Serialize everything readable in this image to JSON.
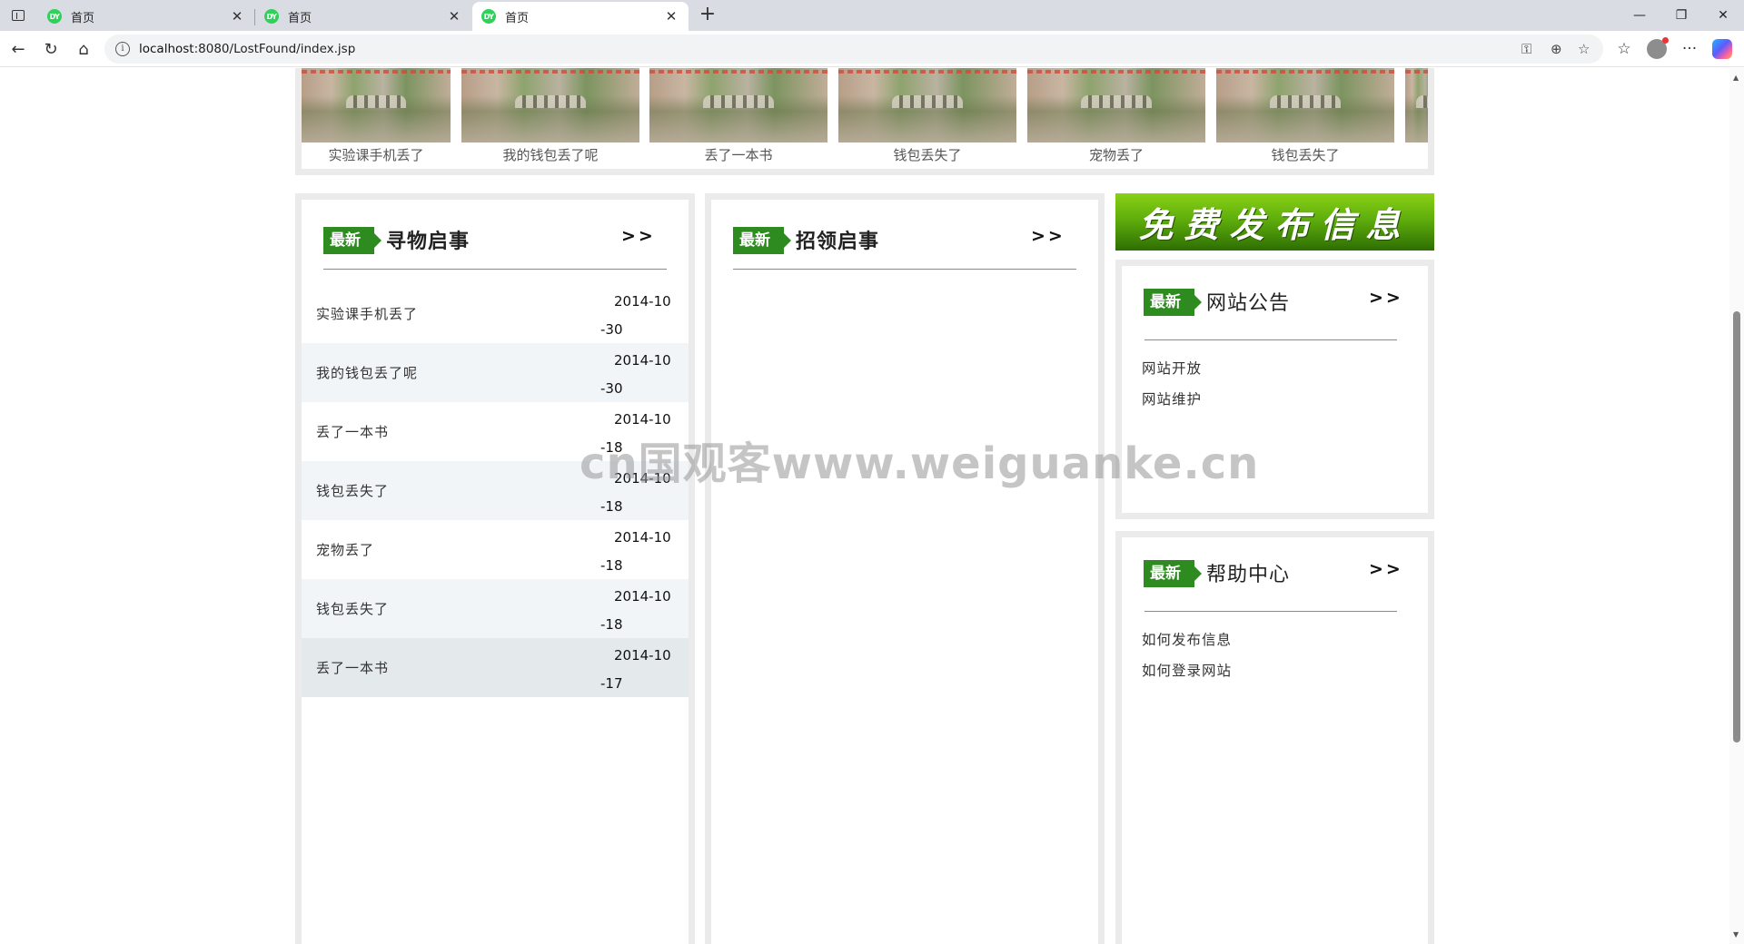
{
  "browser": {
    "tabs": [
      {
        "favicon": "DY",
        "title": "首页",
        "active": false
      },
      {
        "favicon": "DY",
        "title": "首页",
        "active": false
      },
      {
        "favicon": "DY",
        "title": "首页",
        "active": true
      }
    ],
    "url_host": "localhost",
    "url_rest": ":8080/LostFound/index.jsp",
    "icons": {
      "tab-actions": "tab-actions-icon",
      "new-tab": "+",
      "minimize": "—",
      "restore": "❐",
      "close": "✕",
      "back": "←",
      "reload": "↻",
      "home": "⌂",
      "more": "···"
    }
  },
  "carousel": {
    "items": [
      {
        "caption": "实验课手机丢了"
      },
      {
        "caption": "我的钱包丢了呢"
      },
      {
        "caption": "丢了一本书"
      },
      {
        "caption": "钱包丢失了"
      },
      {
        "caption": "宠物丢了"
      },
      {
        "caption": "钱包丢失了"
      },
      {
        "caption": ""
      }
    ]
  },
  "lost": {
    "badge": "最新",
    "title": "寻物启事",
    "more": ">>",
    "items": [
      {
        "name": "实验课手机丢了",
        "date": "2014-10-30"
      },
      {
        "name": "我的钱包丢了呢",
        "date": "2014-10-30"
      },
      {
        "name": "丢了一本书",
        "date": "2014-10-18"
      },
      {
        "name": "钱包丢失了",
        "date": "2014-10-18"
      },
      {
        "name": "宠物丢了",
        "date": "2014-10-18"
      },
      {
        "name": "钱包丢失了",
        "date": "2014-10-18"
      },
      {
        "name": "丢了一本书",
        "date": "2014-10-17"
      }
    ]
  },
  "found": {
    "badge": "最新",
    "title": "招领启事",
    "more": ">>"
  },
  "banner": {
    "text": "免费发布信息"
  },
  "notice": {
    "badge": "最新",
    "title": "网站公告",
    "more": ">>",
    "items": [
      "网站开放",
      "网站维护"
    ]
  },
  "help": {
    "badge": "最新",
    "title": "帮助中心",
    "more": ">>",
    "items": [
      "如何发布信息",
      "如何登录网站"
    ]
  },
  "watermark": "cn国观客www.weiguanke.cn",
  "colors": {
    "badge_green": "#2e8b1f",
    "panel_border": "#ebebeb",
    "row_alt": "#f1f5f8"
  }
}
